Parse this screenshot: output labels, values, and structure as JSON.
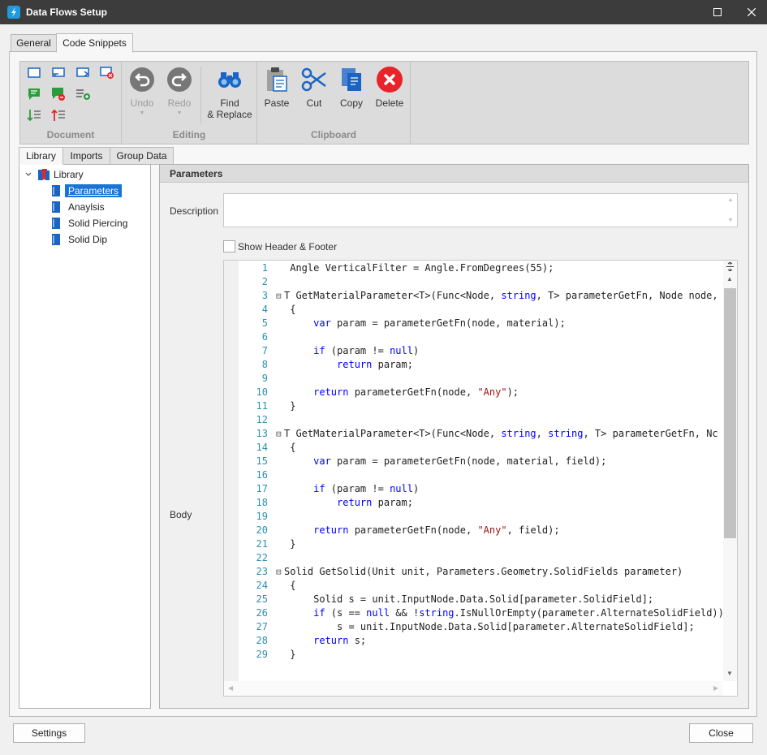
{
  "window": {
    "title": "Data Flows Setup"
  },
  "main_tabs": [
    "General",
    "Code Snippets"
  ],
  "ribbon": {
    "groups": {
      "document": "Document",
      "editing": "Editing",
      "clipboard": "Clipboard"
    },
    "buttons": {
      "undo": "Undo",
      "redo": "Redo",
      "find_line1": "Find",
      "find_line2": "& Replace",
      "paste": "Paste",
      "cut": "Cut",
      "copy": "Copy",
      "delete": "Delete"
    }
  },
  "sub_tabs": [
    "Library",
    "Imports",
    "Group Data"
  ],
  "tree": {
    "root": "Library",
    "items": [
      "Parameters",
      "Anaylsis",
      "Solid Piercing",
      "Solid Dip"
    ]
  },
  "panel": {
    "title": "Parameters",
    "description_label": "Description",
    "description_value": "",
    "show_header_label": "Show Header & Footer",
    "show_header_checked": false,
    "body_label": "Body"
  },
  "code": {
    "line_numbers": [
      "1",
      "2",
      "3",
      "4",
      "5",
      "6",
      "7",
      "8",
      "9",
      "10",
      "11",
      "12",
      "13",
      "14",
      "15",
      "16",
      "17",
      "18",
      "19",
      "20",
      "21",
      "22",
      "23",
      "24",
      "25",
      "26",
      "27",
      "28",
      "29"
    ],
    "lines": [
      [
        [
          "",
          " Angle VerticalFilter = Angle.FromDegrees(55);"
        ]
      ],
      [],
      [
        [
          "f",
          "⊟"
        ],
        [
          "",
          "T GetMaterialParameter<T>(Func<Node, "
        ],
        [
          "kw",
          "string"
        ],
        [
          "",
          ", T> parameterGetFn, Node node,"
        ]
      ],
      [
        [
          "",
          " {"
        ]
      ],
      [
        [
          "",
          "     "
        ],
        [
          "kw",
          "var"
        ],
        [
          "",
          " param = parameterGetFn(node, material);"
        ]
      ],
      [],
      [
        [
          "",
          "     "
        ],
        [
          "kw",
          "if"
        ],
        [
          "",
          " (param != "
        ],
        [
          "kw",
          "null"
        ],
        [
          "",
          ")"
        ]
      ],
      [
        [
          "",
          "         "
        ],
        [
          "kw",
          "return"
        ],
        [
          "",
          " param;"
        ]
      ],
      [],
      [
        [
          "",
          "     "
        ],
        [
          "kw",
          "return"
        ],
        [
          "",
          " parameterGetFn(node, "
        ],
        [
          "str",
          "\"Any\""
        ],
        [
          "",
          ");"
        ]
      ],
      [
        [
          "",
          " }"
        ]
      ],
      [],
      [
        [
          "f",
          "⊟"
        ],
        [
          "",
          "T GetMaterialParameter<T>(Func<Node, "
        ],
        [
          "kw",
          "string"
        ],
        [
          "",
          ", "
        ],
        [
          "kw",
          "string"
        ],
        [
          "",
          ", T> parameterGetFn, Nc"
        ]
      ],
      [
        [
          "",
          " {"
        ]
      ],
      [
        [
          "",
          "     "
        ],
        [
          "kw",
          "var"
        ],
        [
          "",
          " param = parameterGetFn(node, material, field);"
        ]
      ],
      [],
      [
        [
          "",
          "     "
        ],
        [
          "kw",
          "if"
        ],
        [
          "",
          " (param != "
        ],
        [
          "kw",
          "null"
        ],
        [
          "",
          ")"
        ]
      ],
      [
        [
          "",
          "         "
        ],
        [
          "kw",
          "return"
        ],
        [
          "",
          " param;"
        ]
      ],
      [],
      [
        [
          "",
          "     "
        ],
        [
          "kw",
          "return"
        ],
        [
          "",
          " parameterGetFn(node, "
        ],
        [
          "str",
          "\"Any\""
        ],
        [
          "",
          ", field);"
        ]
      ],
      [
        [
          "",
          " }"
        ]
      ],
      [],
      [
        [
          "f",
          "⊟"
        ],
        [
          "",
          "Solid GetSolid(Unit unit, Parameters.Geometry.SolidFields parameter)"
        ]
      ],
      [
        [
          "",
          " {"
        ]
      ],
      [
        [
          "",
          "     Solid s = unit.InputNode.Data.Solid[parameter.SolidField];"
        ]
      ],
      [
        [
          "",
          "     "
        ],
        [
          "kw",
          "if"
        ],
        [
          "",
          " (s == "
        ],
        [
          "kw",
          "null"
        ],
        [
          "",
          " && !"
        ],
        [
          "kw",
          "string"
        ],
        [
          "",
          ".IsNullOrEmpty(parameter.AlternateSolidField))"
        ]
      ],
      [
        [
          "",
          "         s = unit.InputNode.Data.Solid[parameter.AlternateSolidField];"
        ]
      ],
      [
        [
          "",
          "     "
        ],
        [
          "kw",
          "return"
        ],
        [
          "",
          " s;"
        ]
      ],
      [
        [
          "",
          " }"
        ]
      ]
    ]
  },
  "footer": {
    "settings": "Settings",
    "close": "Close"
  },
  "colors": {
    "titlebar": "#3c3c3c",
    "selection": "#1874d6",
    "keyword": "#0000ff",
    "string": "#a31515",
    "line_number": "#2b91af",
    "delete_red": "#e8232a"
  },
  "icons": {
    "undo": "undo-icon",
    "redo": "redo-icon",
    "find": "binoculars-icon",
    "paste": "clipboard-icon",
    "cut": "scissors-icon",
    "copy": "copy-icon",
    "delete": "delete-icon"
  }
}
